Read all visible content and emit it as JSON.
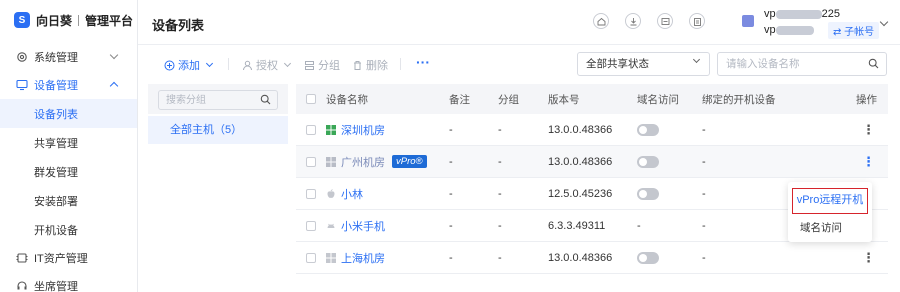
{
  "brand": {
    "logo_letter": "S",
    "name": "向日葵",
    "subtitle": "管理平台",
    "accent": "#2b6ff3"
  },
  "sidebar": {
    "groups": [
      {
        "label": "系统管理",
        "icon": "gear-icon"
      },
      {
        "label": "设备管理",
        "icon": "monitor-icon"
      },
      {
        "label": "IT资产管理",
        "icon": "asset-icon"
      },
      {
        "label": "坐席管理",
        "icon": "seat-icon"
      }
    ],
    "items": [
      "设备列表",
      "共享管理",
      "群发管理",
      "安装部署",
      "开机设备"
    ]
  },
  "header": {
    "title": "设备列表",
    "account_line1_prefix": "vp",
    "account_line1_suffix": "225",
    "account_line2_prefix": "vp",
    "sub_account_badge": "⇄ 子帐号"
  },
  "toolbar": {
    "add": "添加",
    "authorize": "授权",
    "group": "分组",
    "delete": "删除",
    "more": "···",
    "share_status": "全部共享状态",
    "search_placeholder": "请输入设备名称"
  },
  "group_panel": {
    "search_placeholder": "搜索分组",
    "all_hosts": "全部主机（5）"
  },
  "table": {
    "headers": {
      "name": "设备名称",
      "note": "备注",
      "group": "分组",
      "version": "版本号",
      "domain_access": "域名访问",
      "bound_boot_device": "绑定的开机设备",
      "action": "操作"
    },
    "rows": [
      {
        "name": "深圳机房",
        "note": "-",
        "group": "-",
        "version": "13.0.0.48366",
        "toggle": "off",
        "bound": "-",
        "os": "windows"
      },
      {
        "name": "广州机房",
        "vpro": "vPro®",
        "note": "-",
        "group": "-",
        "version": "13.0.0.48366",
        "toggle": "off",
        "bound": "-",
        "os": "windows"
      },
      {
        "name": "小林",
        "note": "-",
        "group": "-",
        "version": "12.5.0.45236",
        "toggle": "off",
        "bound": "-",
        "os": "apple"
      },
      {
        "name": "小米手机",
        "note": "-",
        "group": "-",
        "version": "6.3.3.49311",
        "toggle": "-",
        "bound": "-",
        "os": "android"
      },
      {
        "name": "上海机房",
        "note": "-",
        "group": "-",
        "version": "13.0.0.48366",
        "toggle": "off",
        "bound": "-",
        "os": "windows"
      }
    ]
  },
  "popup": {
    "vpro_boot": "vPro远程开机",
    "domain_access": "域名访问"
  }
}
